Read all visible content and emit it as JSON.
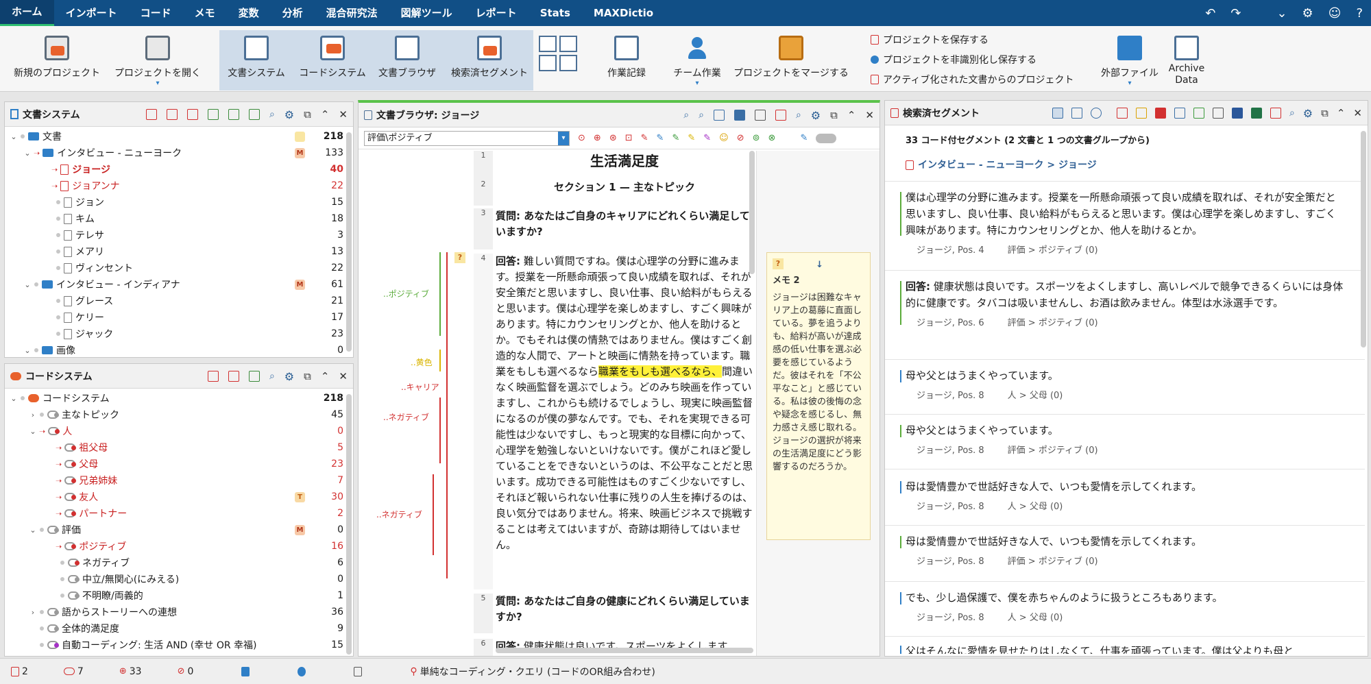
{
  "menu": {
    "items": [
      "ホーム",
      "インポート",
      "コード",
      "メモ",
      "変数",
      "分析",
      "混合研究法",
      "図解ツール",
      "レポート",
      "Stats",
      "MAXDictio"
    ]
  },
  "ribbon": {
    "new_project": "新規のプロジェクト",
    "open_project": "プロジェクトを開く",
    "document_system": "文書システム",
    "code_system": "コードシステム",
    "document_browser": "文書ブラウザ",
    "retrieved_segments": "検索済セグメント",
    "work_log": "作業記録",
    "teamwork": "チーム作業",
    "merge_projects": "プロジェクトをマージする",
    "save_project": "プロジェクトを保存する",
    "save_anonymized": "プロジェクトを非識別化し保存する",
    "project_from_active": "アクティブ化された文書からのプロジェクト",
    "external_files": "外部ファイル",
    "archive_data_1": "Archive",
    "archive_data_2": "Data"
  },
  "doc_system": {
    "title": "文書システム",
    "rows": [
      {
        "label": "文書",
        "count": "218"
      },
      {
        "label": "インタビュー - ニューヨーク",
        "count": "133"
      },
      {
        "label": "ジョージ",
        "count": "40"
      },
      {
        "label": "ジョアンナ",
        "count": "22"
      },
      {
        "label": "ジョン",
        "count": "15"
      },
      {
        "label": "キム",
        "count": "18"
      },
      {
        "label": "テレサ",
        "count": "3"
      },
      {
        "label": "メアリ",
        "count": "13"
      },
      {
        "label": "ヴィンセント",
        "count": "22"
      },
      {
        "label": "インタビュー - インディアナ",
        "count": "61"
      },
      {
        "label": "グレース",
        "count": "21"
      },
      {
        "label": "ケリー",
        "count": "17"
      },
      {
        "label": "ジャック",
        "count": "23"
      },
      {
        "label": "画像",
        "count": "0"
      }
    ]
  },
  "code_system": {
    "title": "コードシステム",
    "rows": [
      {
        "label": "コードシステム",
        "count": "218"
      },
      {
        "label": "主なトピック",
        "count": "45"
      },
      {
        "label": "人",
        "count": "0"
      },
      {
        "label": "祖父母",
        "count": "5"
      },
      {
        "label": "父母",
        "count": "23"
      },
      {
        "label": "兄弟姉妹",
        "count": "7"
      },
      {
        "label": "友人",
        "count": "30"
      },
      {
        "label": "パートナー",
        "count": "2"
      },
      {
        "label": "評価",
        "count": "0"
      },
      {
        "label": "ポジティブ",
        "count": "16"
      },
      {
        "label": "ネガティブ",
        "count": "6"
      },
      {
        "label": "中立/無関心(にみえる)",
        "count": "0"
      },
      {
        "label": "不明瞭/両義的",
        "count": "1"
      },
      {
        "label": "語からストーリーへの連想",
        "count": "36"
      },
      {
        "label": "全体的満足度",
        "count": "9"
      },
      {
        "label": "自動コーディング: 生活 AND (幸せ OR 幸福)",
        "count": "15"
      }
    ]
  },
  "doc_browser": {
    "title": "文書ブラウザ: ジョージ",
    "code_select": "評価\\ポジティブ",
    "paragraphs": [
      {
        "num": "1",
        "text": "生活満足度"
      },
      {
        "num": "2",
        "text": "セクション 1 — 主なトピック"
      },
      {
        "num": "3",
        "label": "質問:",
        "text": " あなたはご自身のキャリアにどれくらい満足していますか?"
      },
      {
        "num": "4",
        "label": "回答:",
        "text_before": " 難しい質問ですね。僕は心理学の分野に進みます。授業を一所懸命頑張って良い成績を取れば、それが安全策だと思いますし、良い仕事、良い給料がもらえると思います。僕は心理学を楽しめますし、すごく興味があります。特にカウンセリングとか、他人を助けるとか。でもそれは僕の情熱ではありません。僕はすごく創造的な人間で、アートと映画に情熱を持っています。職業をもしも選べるなら",
        "highlight": "職業をもしも選べるなら、",
        "text_after": "間違いなく映画監督を選ぶでしょう。どのみち映画を作っていますし、これからも続けるでしょうし、現実に映画監督になるのが僕の夢なんです。でも、それを実現できる可能性は少ないですし、もっと現実的な目標に向かって、心理学を勉強しないといけないです。僕がこれほど愛していることをできないというのは、不公平なことだと思います。成功できる可能性はものすごく少ないですし、それほど報いられない仕事に残りの人生を捧げるのは、良い気分ではありません。将来、映画ビジネスで挑戦することは考えてはいますが、奇跡は期待してはいません。"
      },
      {
        "num": "5",
        "label": "質問:",
        "text": " あなたはご自身の健康にどれくらい満足していますか?"
      },
      {
        "num": "6",
        "label": "回答:",
        "text": " 健康状態は良いです。スポーツをよくします"
      }
    ],
    "code_labels": [
      "..ポジティブ",
      "..黄色",
      "..キャリア",
      "..ネガティブ",
      "..ネガティブ"
    ],
    "memo": {
      "title": "メモ 2",
      "text": "ジョージは困難なキャリア上の葛藤に直面している。夢を追うよりも、給料が高いが達成感の低い仕事を選ぶ必要を感じているようだ。彼はそれを「不公平なこと」と感じている。私は彼の後悔の念や疑念を感じるし、無力感さえ感じ取れる。ジョージの選択が将来の生活満足度にどう影響するのだろうか。"
    }
  },
  "retrieved": {
    "title": "検索済セグメント",
    "summary": "33 コード付セグメント (2 文書と 1 つの文書グループから)",
    "doc_link": "インタビュー - ニューヨーク > ジョージ",
    "segments": [
      {
        "text": "僕は心理学の分野に進みます。授業を一所懸命頑張って良い成績を取れば、それが安全策だと思いますし、良い仕事、良い給料がもらえると思います。僕は心理学を楽しめますし、すごく興味があります。特にカウンセリングとか、他人を助けるとか。",
        "source": "ジョージ, Pos. 4",
        "code": "評価 > ポジティブ (0)",
        "color": "#5aab3a"
      },
      {
        "label": "回答:",
        "text": " 健康状態は良いです。スポーツをよくしますし、高いレベルで競争できるくらいには身体的に健康です。タバコは吸いませんし、お酒は飲みません。体型は水泳選手です。",
        "source": "ジョージ, Pos. 6",
        "code": "評価 > ポジティブ (0)",
        "color": "#5aab3a"
      },
      {
        "text": "母や父とはうまくやっています。",
        "source": "ジョージ, Pos. 8",
        "code": "人 > 父母 (0)",
        "color": "#2f7fc7"
      },
      {
        "text": "母や父とはうまくやっています。",
        "source": "ジョージ, Pos. 8",
        "code": "評価 > ポジティブ (0)",
        "color": "#5aab3a"
      },
      {
        "text": "母は愛情豊かで世話好きな人で、いつも愛情を示してくれます。",
        "source": "ジョージ, Pos. 8",
        "code": "人 > 父母 (0)",
        "color": "#2f7fc7"
      },
      {
        "text": "母は愛情豊かで世話好きな人で、いつも愛情を示してくれます。",
        "source": "ジョージ, Pos. 8",
        "code": "評価 > ポジティブ (0)",
        "color": "#5aab3a"
      },
      {
        "text": "でも、少し過保護で、僕を赤ちゃんのように扱うところもあります。",
        "source": "ジョージ, Pos. 8",
        "code": "人 > 父母 (0)",
        "color": "#2f7fc7"
      },
      {
        "text": "父はそんなに愛情を見せたりはしなくて、仕事を頑張っています。僕は父よりも母と",
        "source": "",
        "code": "",
        "color": "#2f7fc7"
      }
    ]
  },
  "statusbar": {
    "docs": "2",
    "codes": "7",
    "segments": "33",
    "memos": "0",
    "query": "単純なコーディング・クエリ (コードのOR組み合わせ)"
  }
}
